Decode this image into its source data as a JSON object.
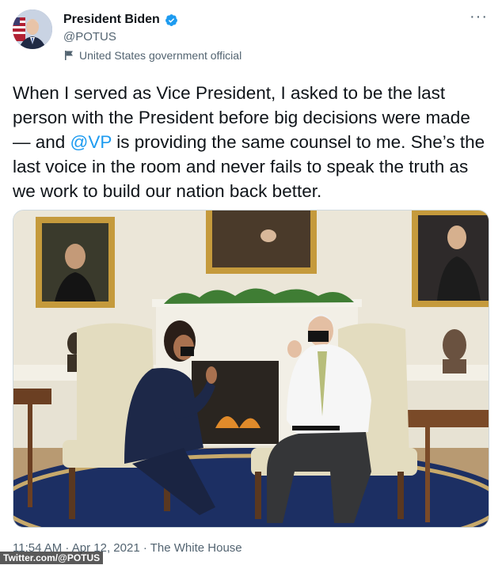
{
  "author": {
    "name": "President Biden",
    "handle": "@POTUS",
    "label": "United States government official"
  },
  "tweet": {
    "text_before": "When I served as Vice President, I asked to be the last person with the President before big decisions were made — and ",
    "mention": "@VP",
    "text_after": " is providing the same counsel to me. She’s the last voice in the room and never fails to speak the truth as we work to build our nation back better."
  },
  "meta": {
    "time": "11:54 AM",
    "sep1": " · ",
    "date": "Apr 12, 2021",
    "sep2": " · ",
    "source": "The White House"
  },
  "watermark": "Twitter.com/@POTUS",
  "colors": {
    "verified": "#1d9bf0",
    "mention": "#1d9bf0",
    "secondary_text": "#536471"
  },
  "icons": [
    "verified-badge-icon",
    "more-options-icon",
    "government-flag-icon"
  ]
}
